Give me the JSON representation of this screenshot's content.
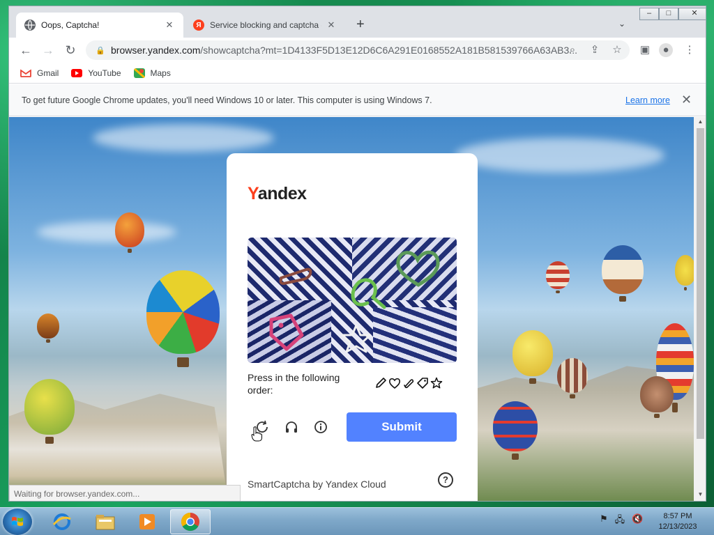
{
  "browser": {
    "tabs": [
      {
        "title": "Oops, Captcha!",
        "active": true
      },
      {
        "title": "Service blocking and captcha - C",
        "active": false
      }
    ],
    "url_host": "browser.yandex.com",
    "url_path": "/showcaptcha?mt=1D4133F5D13E12D6C6A291E0168552A181B581539766A63AB3...",
    "bookmarks": [
      {
        "label": "Gmail"
      },
      {
        "label": "YouTube"
      },
      {
        "label": "Maps"
      }
    ],
    "infobar": {
      "message": "To get future Google Chrome updates, you'll need Windows 10 or later. This computer is using Windows 7.",
      "learn_more": "Learn more"
    },
    "status": "Waiting for browser.yandex.com..."
  },
  "captcha": {
    "logo_first": "Y",
    "logo_rest": "andex",
    "instruction": "Press in the following order:",
    "order_icons": [
      "pencil-icon",
      "heart-icon",
      "paperclip-icon",
      "tag-icon",
      "star-icon"
    ],
    "submit_label": "Submit",
    "footer": "SmartCaptcha by Yandex Cloud"
  },
  "taskbar": {
    "time": "8:57 PM",
    "date": "12/13/2023"
  },
  "colors": {
    "yandex_red": "#fc3f1d",
    "submit_blue": "#5282ff",
    "chrome_link": "#1a73e8"
  }
}
